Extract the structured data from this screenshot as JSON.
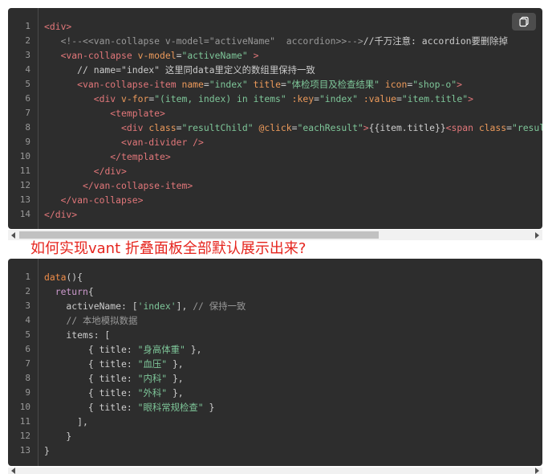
{
  "block1": {
    "copy_label": "copy",
    "lines": [
      {
        "n": "1",
        "segs": [
          {
            "c": "tag",
            "t": "<div>"
          }
        ]
      },
      {
        "n": "2",
        "segs": [
          {
            "c": "txt",
            "t": "   "
          },
          {
            "c": "com",
            "t": "<!--<<van-collapse v-model=\"activeName\"  accordion>>-->"
          },
          {
            "c": "txt",
            "t": "//千万注意: accordion要删除掉"
          }
        ]
      },
      {
        "n": "3",
        "segs": [
          {
            "c": "txt",
            "t": "   "
          },
          {
            "c": "tag",
            "t": "<van-collapse"
          },
          {
            "c": "txt",
            "t": " "
          },
          {
            "c": "attr",
            "t": "v-model"
          },
          {
            "c": "pun",
            "t": "="
          },
          {
            "c": "str",
            "t": "\"activeName\""
          },
          {
            "c": "txt",
            "t": " "
          },
          {
            "c": "tag",
            "t": ">"
          }
        ]
      },
      {
        "n": "4",
        "segs": [
          {
            "c": "txt",
            "t": "      // name=\"index\" 这里同data里定义的数组里保持一致"
          }
        ]
      },
      {
        "n": "5",
        "segs": [
          {
            "c": "txt",
            "t": "      "
          },
          {
            "c": "tag",
            "t": "<van-collapse-item"
          },
          {
            "c": "txt",
            "t": " "
          },
          {
            "c": "attr",
            "t": "name"
          },
          {
            "c": "pun",
            "t": "="
          },
          {
            "c": "str",
            "t": "\"index\""
          },
          {
            "c": "txt",
            "t": " "
          },
          {
            "c": "attr",
            "t": "title"
          },
          {
            "c": "pun",
            "t": "="
          },
          {
            "c": "str",
            "t": "\"体检项目及检查结果\""
          },
          {
            "c": "txt",
            "t": " "
          },
          {
            "c": "attr",
            "t": "icon"
          },
          {
            "c": "pun",
            "t": "="
          },
          {
            "c": "str",
            "t": "\"shop-o\""
          },
          {
            "c": "tag",
            "t": ">"
          }
        ]
      },
      {
        "n": "6",
        "segs": [
          {
            "c": "txt",
            "t": "         "
          },
          {
            "c": "tag",
            "t": "<div"
          },
          {
            "c": "txt",
            "t": " "
          },
          {
            "c": "attr",
            "t": "v-for"
          },
          {
            "c": "pun",
            "t": "="
          },
          {
            "c": "str",
            "t": "\"(item, index) in items\""
          },
          {
            "c": "txt",
            "t": " "
          },
          {
            "c": "attr",
            "t": ":key"
          },
          {
            "c": "pun",
            "t": "="
          },
          {
            "c": "str",
            "t": "\"index\""
          },
          {
            "c": "txt",
            "t": " "
          },
          {
            "c": "attr",
            "t": ":value"
          },
          {
            "c": "pun",
            "t": "="
          },
          {
            "c": "str",
            "t": "\"item.title\""
          },
          {
            "c": "tag",
            "t": ">"
          }
        ]
      },
      {
        "n": "7",
        "segs": [
          {
            "c": "txt",
            "t": "            "
          },
          {
            "c": "tag",
            "t": "<template>"
          }
        ]
      },
      {
        "n": "8",
        "segs": [
          {
            "c": "txt",
            "t": "              "
          },
          {
            "c": "tag",
            "t": "<div"
          },
          {
            "c": "txt",
            "t": " "
          },
          {
            "c": "attr",
            "t": "class"
          },
          {
            "c": "pun",
            "t": "="
          },
          {
            "c": "str",
            "t": "\"resultChild\""
          },
          {
            "c": "txt",
            "t": " "
          },
          {
            "c": "attr",
            "t": "@click"
          },
          {
            "c": "pun",
            "t": "="
          },
          {
            "c": "str",
            "t": "\"eachResult\""
          },
          {
            "c": "tag",
            "t": ">"
          },
          {
            "c": "txt",
            "t": "{{item.title}}"
          },
          {
            "c": "tag",
            "t": "<span"
          },
          {
            "c": "txt",
            "t": " "
          },
          {
            "c": "attr",
            "t": "class"
          },
          {
            "c": "pun",
            "t": "="
          },
          {
            "c": "str",
            "t": "\"result_c"
          }
        ]
      },
      {
        "n": "9",
        "segs": [
          {
            "c": "txt",
            "t": "              "
          },
          {
            "c": "tag",
            "t": "<van-divider"
          },
          {
            "c": "txt",
            "t": " "
          },
          {
            "c": "tag",
            "t": "/>"
          }
        ]
      },
      {
        "n": "10",
        "segs": [
          {
            "c": "txt",
            "t": "            "
          },
          {
            "c": "tag",
            "t": "</template>"
          }
        ]
      },
      {
        "n": "11",
        "segs": [
          {
            "c": "txt",
            "t": "         "
          },
          {
            "c": "tag",
            "t": "</div>"
          }
        ]
      },
      {
        "n": "12",
        "segs": [
          {
            "c": "txt",
            "t": "       "
          },
          {
            "c": "tag",
            "t": "</van-collapse-item>"
          }
        ]
      },
      {
        "n": "13",
        "segs": [
          {
            "c": "txt",
            "t": "   "
          },
          {
            "c": "tag",
            "t": "</van-collapse>"
          }
        ]
      },
      {
        "n": "14",
        "segs": [
          {
            "c": "tag",
            "t": "</div>"
          }
        ]
      }
    ]
  },
  "question": "如何实现vant 折叠面板全部默认展示出来?",
  "block2": {
    "lines": [
      {
        "n": "1",
        "segs": [
          {
            "c": "fn",
            "t": "data"
          },
          {
            "c": "pun",
            "t": "(){"
          }
        ]
      },
      {
        "n": "2",
        "segs": [
          {
            "c": "txt",
            "t": "  "
          },
          {
            "c": "kw",
            "t": "return"
          },
          {
            "c": "pun",
            "t": "{"
          }
        ]
      },
      {
        "n": "3",
        "segs": [
          {
            "c": "txt",
            "t": "    activeName: ["
          },
          {
            "c": "str",
            "t": "'index'"
          },
          {
            "c": "txt",
            "t": "], "
          },
          {
            "c": "com",
            "t": "// 保持一致"
          }
        ]
      },
      {
        "n": "4",
        "segs": [
          {
            "c": "txt",
            "t": "    "
          },
          {
            "c": "com",
            "t": "// 本地模拟数据"
          }
        ]
      },
      {
        "n": "5",
        "segs": [
          {
            "c": "txt",
            "t": "    items: ["
          }
        ]
      },
      {
        "n": "6",
        "segs": [
          {
            "c": "txt",
            "t": "        { title: "
          },
          {
            "c": "str",
            "t": "\"身高体重\""
          },
          {
            "c": "txt",
            "t": " },"
          }
        ]
      },
      {
        "n": "7",
        "segs": [
          {
            "c": "txt",
            "t": "        { title: "
          },
          {
            "c": "str",
            "t": "\"血压\""
          },
          {
            "c": "txt",
            "t": " },"
          }
        ]
      },
      {
        "n": "8",
        "segs": [
          {
            "c": "txt",
            "t": "        { title: "
          },
          {
            "c": "str",
            "t": "\"内科\""
          },
          {
            "c": "txt",
            "t": " },"
          }
        ]
      },
      {
        "n": "9",
        "segs": [
          {
            "c": "txt",
            "t": "        { title: "
          },
          {
            "c": "str",
            "t": "\"外科\""
          },
          {
            "c": "txt",
            "t": " },"
          }
        ]
      },
      {
        "n": "10",
        "segs": [
          {
            "c": "txt",
            "t": "        { title: "
          },
          {
            "c": "str",
            "t": "\"眼科常规检查\""
          },
          {
            "c": "txt",
            "t": " }"
          }
        ]
      },
      {
        "n": "11",
        "segs": [
          {
            "c": "txt",
            "t": "      ],"
          }
        ]
      },
      {
        "n": "12",
        "segs": [
          {
            "c": "txt",
            "t": "    }"
          }
        ]
      },
      {
        "n": "13",
        "segs": [
          {
            "c": "txt",
            "t": "}"
          }
        ]
      }
    ]
  }
}
